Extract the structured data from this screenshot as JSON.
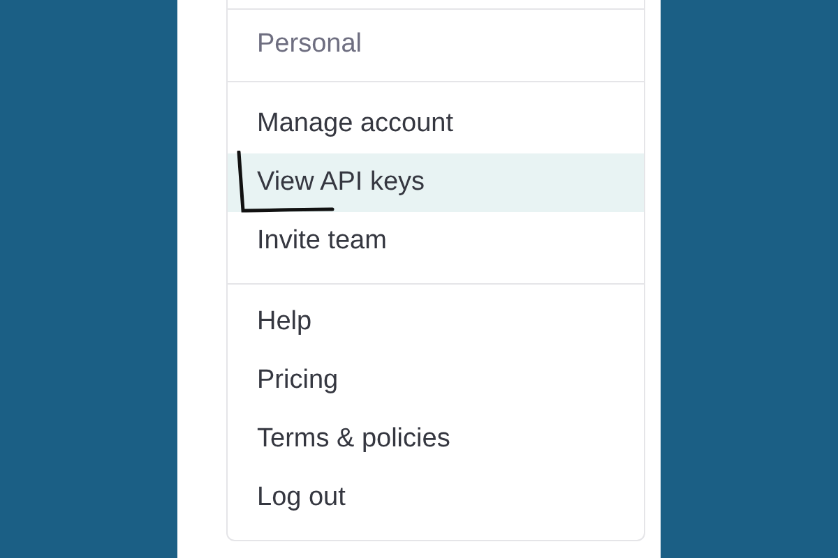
{
  "menu": {
    "header": "Personal",
    "sections": [
      {
        "items": [
          {
            "label": "Manage account",
            "selected": false
          },
          {
            "label": "View API keys",
            "selected": true
          },
          {
            "label": "Invite team",
            "selected": false
          }
        ]
      },
      {
        "items": [
          {
            "label": "Help",
            "selected": false
          },
          {
            "label": "Pricing",
            "selected": false
          },
          {
            "label": "Terms & policies",
            "selected": false
          },
          {
            "label": "Log out",
            "selected": false
          }
        ]
      }
    ]
  }
}
